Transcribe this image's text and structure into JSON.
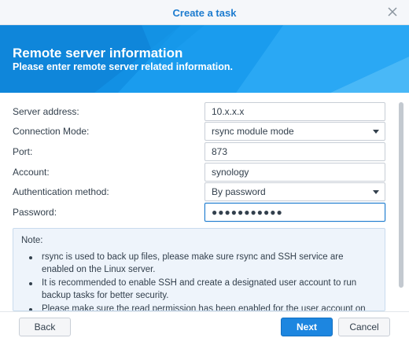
{
  "dialog": {
    "title": "Create a task"
  },
  "banner": {
    "heading": "Remote server information",
    "subheading": "Please enter remote server related information."
  },
  "form": {
    "server_address": {
      "label": "Server address:",
      "value": "10.x.x.x"
    },
    "connection_mode": {
      "label": "Connection Mode:",
      "value": "rsync module mode"
    },
    "port": {
      "label": "Port:",
      "value": "873"
    },
    "account": {
      "label": "Account:",
      "value": "synology"
    },
    "auth_method": {
      "label": "Authentication method:",
      "value": "By password"
    },
    "password": {
      "label": "Password:",
      "value": "●●●●●●●●●●●"
    }
  },
  "note": {
    "title": "Note:",
    "items": [
      "rsync is used to back up files, please make sure rsync and SSH service are enabled on the Linux server.",
      "It is recommended to enable SSH and create a designated user account to run backup tasks for better security.",
      "Please make sure the read permission has been enabled for the user account on the"
    ]
  },
  "footer": {
    "back_label": "Back",
    "next_label": "Next",
    "cancel_label": "Cancel"
  },
  "colors": {
    "accent": "#1d7ccf",
    "banner": "#1290e4",
    "note_bg": "#eef4fb"
  },
  "icons": {
    "close": "close-icon",
    "dropdown": "chevron-down-icon"
  }
}
